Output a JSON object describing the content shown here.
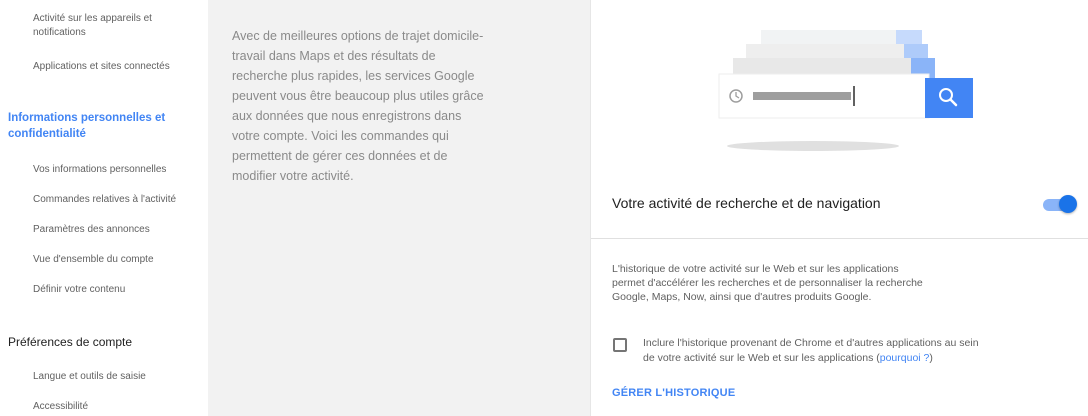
{
  "sidebar": {
    "items_top": [
      "Activité sur les appareils et",
      "notifications",
      "Applications et sites connectés"
    ],
    "section_privacy": [
      "Informations personnelles et",
      "confidentialité"
    ],
    "privacy_items": [
      "Vos informations personnelles",
      "Commandes relatives à l'activité",
      "Paramètres des annonces",
      "Vue d'ensemble du compte",
      "Définir votre contenu"
    ],
    "section_prefs": "Préférences de compte",
    "prefs_items": [
      "Langue et outils de saisie",
      "Accessibilité"
    ]
  },
  "description": {
    "lines": [
      "Avec de meilleures options de trajet domicile-",
      "travail dans Maps et des résultats de",
      "recherche plus rapides, les services Google",
      "peuvent vous être beaucoup plus utiles grâce",
      "aux données que nous enregistrons dans",
      "votre compte. Voici les commandes qui",
      "permettent de gérer ces données et de",
      "modifier votre activité."
    ]
  },
  "card": {
    "title": "Votre activité de recherche et de navigation",
    "toggle_on": true,
    "info_lines": [
      "L'historique de votre activité sur le Web et sur les applications",
      "permet d'accélérer les recherches et de personnaliser la recherche",
      "Google, Maps, Now, ainsi que d'autres produits Google."
    ],
    "checkbox_checked": false,
    "checkbox_line1": "Inclure l'historique provenant de Chrome et d'autres applications au sein",
    "checkbox_line2": "de votre activité sur le Web et sur les applications (",
    "checkbox_link": "pourquoi ?",
    "checkbox_line2_end": ")",
    "manage_label": "GÉRER L'HISTORIQUE",
    "colors": {
      "accent": "#4285f4",
      "toggle_knob": "#1a73e8",
      "toggle_track": "#8ab4f8"
    }
  },
  "icons": {
    "search": "search-icon",
    "clock": "clock-icon"
  }
}
